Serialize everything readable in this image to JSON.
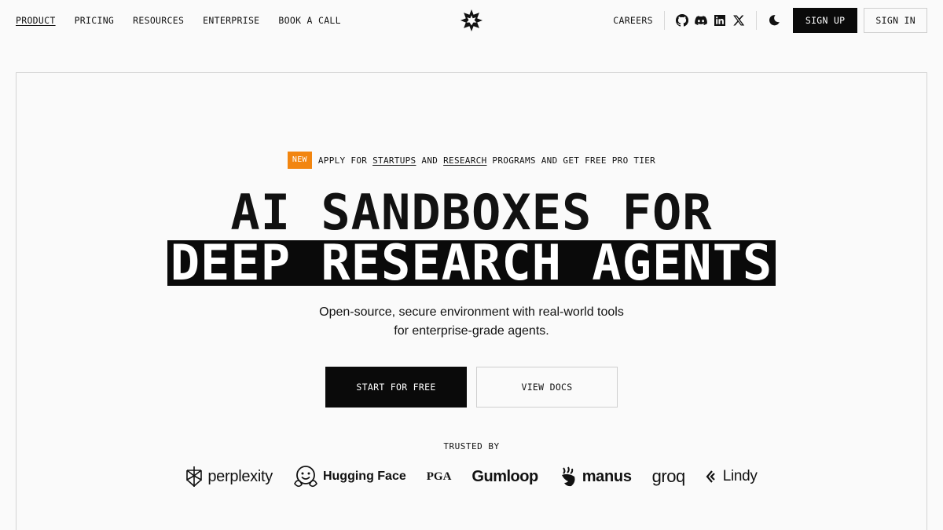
{
  "nav": {
    "links": [
      "PRODUCT",
      "PRICING",
      "RESOURCES",
      "ENTERPRISE",
      "BOOK A CALL"
    ],
    "careers": "CAREERS",
    "sign_up": "SIGN UP",
    "sign_in": "SIGN IN",
    "social_icons": [
      "github-icon",
      "discord-icon",
      "linkedin-icon",
      "x-icon"
    ],
    "theme_icon": "moon-icon"
  },
  "announcement": {
    "badge": "NEW",
    "text_1": "APPLY FOR ",
    "link_1": "STARTUPS",
    "text_2": " AND ",
    "link_2": "RESEARCH",
    "text_3": " PROGRAMS AND GET FREE PRO TIER",
    "badge_color": "#f2850f"
  },
  "hero": {
    "line_1": "AI SANDBOXES FOR",
    "line_2": "DEEP RESEARCH AGENTS",
    "sub_1": "Open-source, secure environment with real-world tools",
    "sub_2": "for enterprise-grade agents."
  },
  "cta": {
    "primary": "START FOR FREE",
    "secondary": "VIEW DOCS"
  },
  "trusted": {
    "label": "TRUSTED BY",
    "logos": [
      "perplexity",
      "Hugging Face",
      "PGA",
      "Gumloop",
      "manus",
      "groq",
      "Lindy"
    ]
  }
}
